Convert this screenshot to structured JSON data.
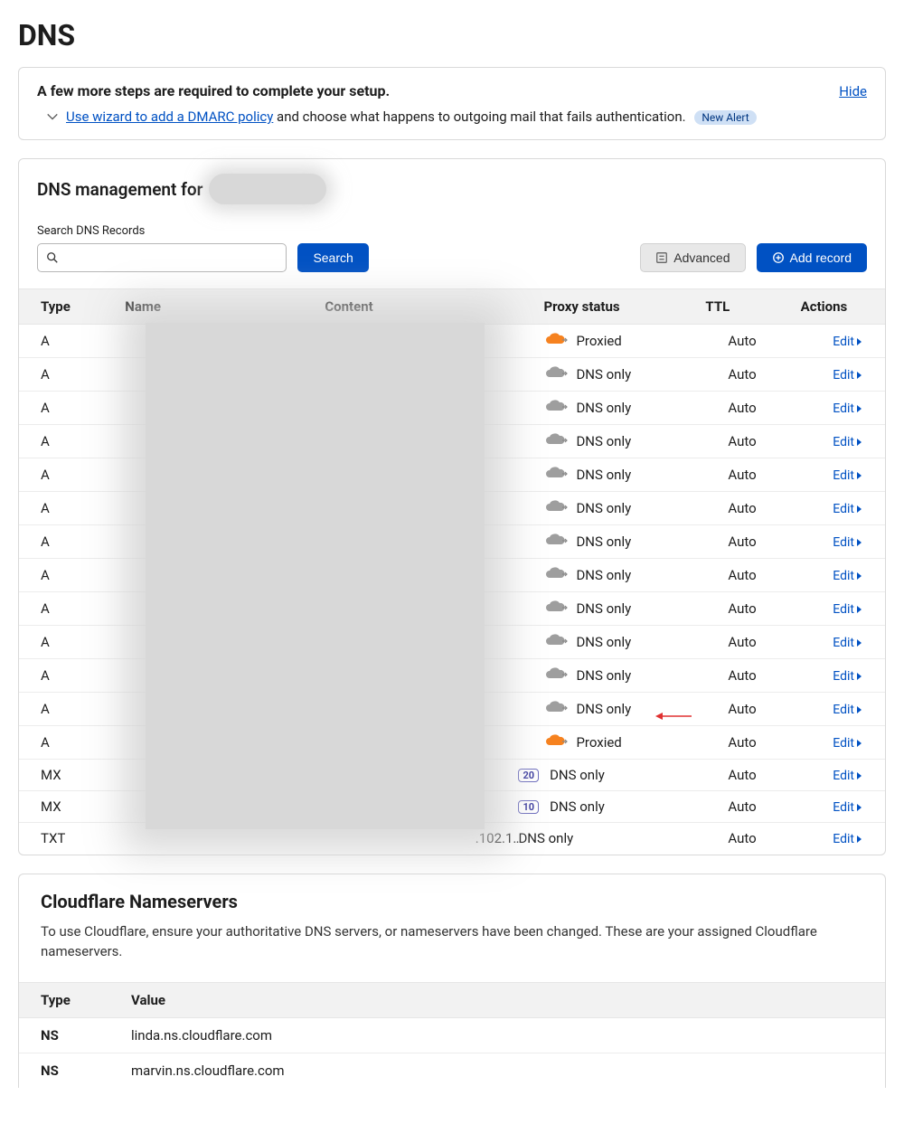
{
  "page_title": "DNS",
  "setup": {
    "title": "A few more steps are required to complete your setup.",
    "hide": "Hide",
    "wizard_link": "Use wizard to add a DMARC policy",
    "wizard_rest": " and choose what happens to outgoing mail that fails authentication.",
    "new_alert": "New Alert"
  },
  "management": {
    "title_prefix": "DNS management for",
    "search_label": "Search DNS Records",
    "search_btn": "Search",
    "advanced_btn": "Advanced",
    "add_record_btn": "Add record"
  },
  "columns": {
    "type": "Type",
    "name": "Name",
    "content": "Content",
    "proxy": "Proxy status",
    "ttl": "TTL",
    "actions": "Actions"
  },
  "edit_label": "Edit",
  "records": [
    {
      "type": "A",
      "name": "",
      "content": "",
      "priority": null,
      "proxy": "Proxied",
      "ttl": "Auto"
    },
    {
      "type": "A",
      "name": "",
      "content": "",
      "priority": null,
      "proxy": "DNS only",
      "ttl": "Auto"
    },
    {
      "type": "A",
      "name": "",
      "content": "",
      "priority": null,
      "proxy": "DNS only",
      "ttl": "Auto"
    },
    {
      "type": "A",
      "name": "",
      "content": "",
      "priority": null,
      "proxy": "DNS only",
      "ttl": "Auto"
    },
    {
      "type": "A",
      "name": "",
      "content": "",
      "priority": null,
      "proxy": "DNS only",
      "ttl": "Auto"
    },
    {
      "type": "A",
      "name": "",
      "content": "",
      "priority": null,
      "proxy": "DNS only",
      "ttl": "Auto"
    },
    {
      "type": "A",
      "name": "",
      "content": "",
      "priority": null,
      "proxy": "DNS only",
      "ttl": "Auto"
    },
    {
      "type": "A",
      "name": "",
      "content": "",
      "priority": null,
      "proxy": "DNS only",
      "ttl": "Auto"
    },
    {
      "type": "A",
      "name": "",
      "content": "",
      "priority": null,
      "proxy": "DNS only",
      "ttl": "Auto"
    },
    {
      "type": "A",
      "name": "",
      "content": "",
      "priority": null,
      "proxy": "DNS only",
      "ttl": "Auto"
    },
    {
      "type": "A",
      "name": "",
      "content": "",
      "priority": null,
      "proxy": "DNS only",
      "ttl": "Auto"
    },
    {
      "type": "A",
      "name": "",
      "content": "",
      "priority": null,
      "proxy": "DNS only",
      "ttl": "Auto"
    },
    {
      "type": "A",
      "name": "",
      "content": "",
      "priority": null,
      "proxy": "Proxied",
      "ttl": "Auto"
    },
    {
      "type": "MX",
      "name": "",
      "content": "",
      "priority": "20",
      "proxy": "DNS only",
      "ttl": "Auto"
    },
    {
      "type": "MX",
      "name": "",
      "content": "",
      "priority": "10",
      "proxy": "DNS only",
      "ttl": "Auto"
    },
    {
      "type": "TXT",
      "name": "",
      "content": ".102.1…",
      "priority": null,
      "proxy": "DNS only",
      "ttl": "Auto"
    }
  ],
  "nameservers": {
    "title": "Cloudflare Nameservers",
    "desc": "To use Cloudflare, ensure your authoritative DNS servers, or nameservers have been changed. These are your assigned Cloudflare nameservers.",
    "col_type": "Type",
    "col_value": "Value",
    "rows": [
      {
        "type": "NS",
        "value": "linda.ns.cloudflare.com"
      },
      {
        "type": "NS",
        "value": "marvin.ns.cloudflare.com"
      }
    ]
  }
}
